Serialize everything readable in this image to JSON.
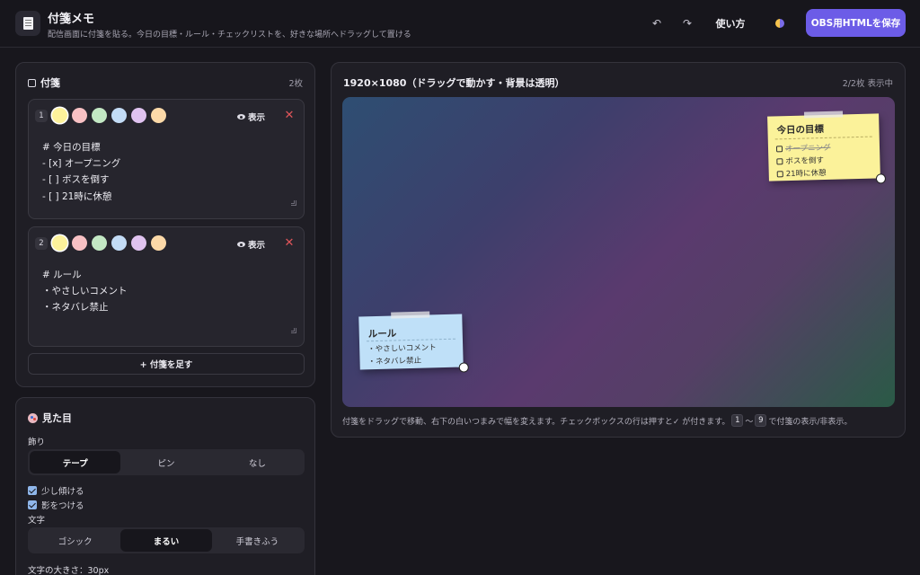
{
  "header": {
    "title": "付箋メモ",
    "subtitle": "配信画面に付箋を貼る。今日の目標・ルール・チェックリストを、好きな場所へドラッグして置ける",
    "undo_icon": "↶",
    "redo_icon": "↷",
    "help_label": "使い方",
    "save_label": "OBS用HTMLを保存"
  },
  "notes_panel": {
    "title": "付箋",
    "count": "2枚",
    "add_label": "+ 付箋を足す",
    "cards": [
      {
        "number": "1",
        "visibility_label": "表示",
        "close_icon": "✕",
        "text": "# 今日の目標\n- [x] オープニング\n- [ ] ボスを倒す\n- [ ] 21時に休憩",
        "selected_color": 0
      },
      {
        "number": "2",
        "visibility_label": "表示",
        "close_icon": "✕",
        "text": "# ルール\n・やさしいコメント\n・ネタバレ禁止",
        "selected_color": 0
      }
    ],
    "swatch_colors": [
      "#fdf29b",
      "#f8c1c4",
      "#c3e8c4",
      "#c3dcf6",
      "#e0c3f0",
      "#fcd9a8"
    ]
  },
  "look_panel": {
    "title": "見た目",
    "decoration_label": "飾り",
    "decoration_options": [
      "テープ",
      "ピン",
      "なし"
    ],
    "decoration_selected": "テープ",
    "tilt_label": "少し傾ける",
    "tilt_checked": true,
    "shadow_label": "影をつける",
    "shadow_checked": true,
    "font_label": "文字",
    "font_options": [
      "ゴシック",
      "まるい",
      "手書きふう"
    ],
    "font_selected": "まるい",
    "font_size_label": "文字の大きさ：30px"
  },
  "preview": {
    "title": "1920×1080（ドラッグで動かす・背景は透明）",
    "status": "2/2枚 表示中",
    "hint_before": "付箋をドラッグで移動、右下の白いつまみで幅を変えます。チェックボックスの行は押すと✓ が付きます。",
    "key_from": "1",
    "key_sep": "〜",
    "key_to": "9",
    "hint_after": "で付箋の表示/非表示。",
    "stickies": [
      {
        "title": "今日の目標",
        "items": [
          {
            "text": "オープニング",
            "checked": true
          },
          {
            "text": "ボスを倒す",
            "checked": false
          },
          {
            "text": "21時に休憩",
            "checked": false
          }
        ]
      },
      {
        "title": "ルール",
        "lines": [
          "・やさしいコメント",
          "・ネタバレ禁止"
        ]
      }
    ]
  },
  "colors": {
    "accent": "#6c5ce7",
    "sticky_yellow": "#fbf29a",
    "sticky_blue": "#bfe0f8",
    "close_red": "#e0555a"
  }
}
